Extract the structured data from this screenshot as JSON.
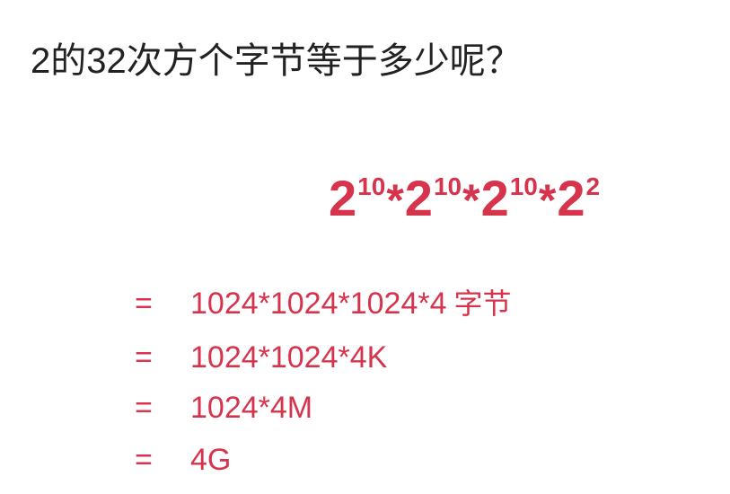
{
  "slide": {
    "title": "2的32次方个字节等于多少呢？",
    "formula": {
      "terms": [
        {
          "base": "2",
          "exponent": "10",
          "operator": "*"
        },
        {
          "base": "2",
          "exponent": "10",
          "operator": "*"
        },
        {
          "base": "2",
          "exponent": "10",
          "operator": "*"
        },
        {
          "base": "2",
          "exponent": "2",
          "operator": ""
        }
      ]
    },
    "lines": [
      {
        "eq": "=",
        "value": "1024*1024*1024*4",
        "unit": "字节"
      },
      {
        "eq": "=",
        "value": "1024*1024*4K",
        "unit": ""
      },
      {
        "eq": "=",
        "value": "1024*4M",
        "unit": ""
      },
      {
        "eq": "=",
        "value": "4G",
        "unit": ""
      }
    ],
    "colors": {
      "accent": "#d6334d",
      "text": "#222222",
      "background": "#ffffff"
    }
  }
}
